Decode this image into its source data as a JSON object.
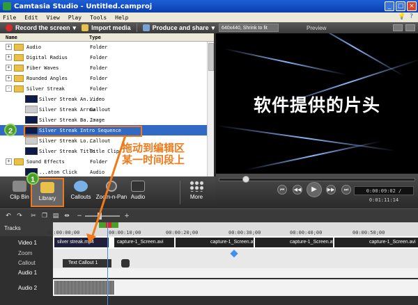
{
  "window": {
    "title": "Camtasia Studio - Untitled.camproj"
  },
  "menu": [
    "File",
    "Edit",
    "View",
    "Play",
    "Tools",
    "Help"
  ],
  "toolbar": {
    "record_label": "Record the screen",
    "import_label": "Import media",
    "produce_label": "Produce and share"
  },
  "preview": {
    "size_select": "640x440, Shrink to fit",
    "label": "Preview",
    "overlay_text": "软件提供的片头",
    "time": "0:00:09:02 / 0:01:11:14"
  },
  "library": {
    "columns": {
      "name": "Name",
      "type": "Type"
    },
    "rows": [
      {
        "kind": "folder",
        "expander": "+",
        "name": "Audio",
        "type": "Folder"
      },
      {
        "kind": "folder",
        "expander": "+",
        "name": "Digital Radius",
        "type": "Folder"
      },
      {
        "kind": "folder",
        "expander": "+",
        "name": "Fiber Waves",
        "type": "Folder"
      },
      {
        "kind": "folder",
        "expander": "+",
        "name": "Rounded Angles",
        "type": "Folder"
      },
      {
        "kind": "folder",
        "expander": "-",
        "name": "Silver Streak",
        "type": "Folder"
      },
      {
        "kind": "item",
        "thumb": "video",
        "name": "Silver Streak An...",
        "type": "Video"
      },
      {
        "kind": "item",
        "thumb": "arrow",
        "name": "Silver Streak Arrow",
        "type": "Callout"
      },
      {
        "kind": "item",
        "thumb": "video",
        "name": "Silver Streak Ba...",
        "type": "Image"
      },
      {
        "kind": "item",
        "thumb": "video",
        "name": "Silver Streak Intro Sequence",
        "type": "",
        "selected": true
      },
      {
        "kind": "item",
        "thumb": "arrow",
        "name": "Silver Streak Lo...",
        "type": "Callout"
      },
      {
        "kind": "item",
        "thumb": "video",
        "name": "Silver Streak Title",
        "type": "Title Clip"
      },
      {
        "kind": "folder",
        "expander": "+",
        "name": "Sound Effects",
        "type": "Folder"
      },
      {
        "kind": "item",
        "thumb": "audio",
        "name": "...aton Click",
        "type": "Audio"
      }
    ]
  },
  "annotation": {
    "badge_1": "1",
    "badge_2": "2",
    "note_line1": "拖动到编辑区",
    "note_line2": "某一时间段上"
  },
  "tabs": [
    {
      "label": "Clip Bin",
      "icon": "film-icon"
    },
    {
      "label": "Library",
      "icon": "folder-icon",
      "active": true
    },
    {
      "label": "Callouts",
      "icon": "speech-bubble-icon"
    },
    {
      "label": "Zoom-n-Pan",
      "icon": "magnifier-icon"
    },
    {
      "label": "Audio",
      "icon": "speaker-icon"
    },
    {
      "label": "More",
      "icon": "dots-icon"
    }
  ],
  "timeline": {
    "tracks_label": "Tracks",
    "ruler_ticks": [
      "00:00:00;00",
      "00:00:10;00",
      "00:00:20;00",
      "00:00:30;00",
      "00:00:40;00",
      "00:00:50;00"
    ],
    "tracks": [
      {
        "name": "Video 1"
      },
      {
        "name": "Zoom"
      },
      {
        "name": "Callout"
      },
      {
        "name": "Audio 1"
      },
      {
        "name": "Audio 2"
      }
    ],
    "clips": {
      "video_silver": "silver streak.mp4",
      "video_capture": [
        "capture-1_Screen.avi",
        "capture-1_Screen.avi",
        "capture-1_Screen.avi",
        "capture-1_Screen.avi",
        "capture-1_Screen.avi"
      ],
      "callout": "Text Callout 1"
    }
  },
  "colors": {
    "accent_orange": "#f07a1a",
    "selection_blue": "#316ac5",
    "titlebar_blue": "#0a3fb0"
  }
}
